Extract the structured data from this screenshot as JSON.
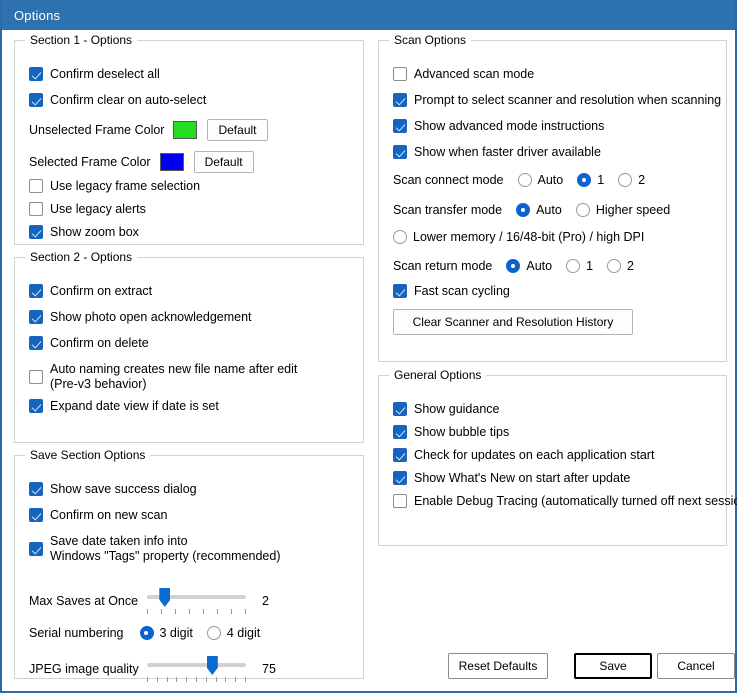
{
  "window": {
    "title": "Options",
    "accent": "#2D71AE"
  },
  "colors": {
    "unselected_frame": "#22DD22",
    "selected_frame": "#0000EE",
    "checkbox_on": "#1565C0",
    "radio_on": "#0B63CE",
    "slider_thumb": "#0B6BD1"
  },
  "section1": {
    "legend": "Section 1 - Options",
    "items": [
      {
        "label": "Confirm deselect all",
        "checked": true
      },
      {
        "label": "Confirm clear on auto-select",
        "checked": true
      }
    ],
    "unselected_frame_color_label": "Unselected Frame Color",
    "unselected_default_button": "Default",
    "selected_frame_color_label": "Selected Frame Color",
    "selected_default_button": "Default",
    "items2": [
      {
        "label": "Use legacy frame selection",
        "checked": false
      },
      {
        "label": "Use legacy alerts",
        "checked": false
      },
      {
        "label": "Show zoom box",
        "checked": true
      }
    ]
  },
  "section2": {
    "legend": "Section 2 - Options",
    "items": [
      {
        "label": "Confirm on extract",
        "checked": true
      },
      {
        "label": "Show photo open acknowledgement",
        "checked": true
      },
      {
        "label": "Confirm on delete",
        "checked": true
      },
      {
        "label": "Auto naming creates new file name after edit",
        "label2": "(Pre-v3 behavior)",
        "checked": false
      },
      {
        "label": "Expand date view if date is set",
        "checked": true
      }
    ]
  },
  "save_section": {
    "legend": "Save Section Options",
    "items": [
      {
        "label": "Show save success dialog",
        "checked": true
      },
      {
        "label": "Confirm on new scan",
        "checked": true
      },
      {
        "label": "Save date taken info into",
        "label2": "Windows \"Tags\" property (recommended)",
        "checked": true
      }
    ],
    "max_saves": {
      "label": "Max Saves at Once",
      "value": "2",
      "percent": 14,
      "ticks": 8
    },
    "serial": {
      "label": "Serial numbering",
      "options": [
        {
          "label": "3 digit",
          "selected": true
        },
        {
          "label": "4 digit",
          "selected": false
        }
      ]
    },
    "jpeg": {
      "label": "JPEG image quality",
      "value": "75",
      "percent": 68,
      "ticks": 11
    }
  },
  "scan_options": {
    "legend": "Scan Options",
    "items": [
      {
        "label": "Advanced scan mode",
        "checked": false
      },
      {
        "label": "Prompt to select scanner and resolution when scanning",
        "checked": true
      },
      {
        "label": "Show advanced mode instructions",
        "checked": true
      },
      {
        "label": "Show when faster driver available",
        "checked": true
      }
    ],
    "connect_mode": {
      "label": "Scan connect mode",
      "options": [
        {
          "label": "Auto",
          "selected": false
        },
        {
          "label": "1",
          "selected": true
        },
        {
          "label": "2",
          "selected": false
        }
      ]
    },
    "transfer_mode": {
      "label": "Scan transfer mode",
      "options": [
        {
          "label": "Auto",
          "selected": true
        },
        {
          "label": "Higher speed",
          "selected": false
        }
      ],
      "extra_option": {
        "label": "Lower memory / 16/48-bit (Pro) / high DPI",
        "selected": false
      }
    },
    "return_mode": {
      "label": "Scan return mode",
      "options": [
        {
          "label": "Auto",
          "selected": true
        },
        {
          "label": "1",
          "selected": false
        },
        {
          "label": "2",
          "selected": false
        }
      ]
    },
    "fast_scan": {
      "label": "Fast scan cycling",
      "checked": true
    },
    "clear_history_button": "Clear Scanner and Resolution History"
  },
  "general_options": {
    "legend": "General Options",
    "items": [
      {
        "label": "Show guidance",
        "checked": true
      },
      {
        "label": "Show bubble tips",
        "checked": true
      },
      {
        "label": "Check for updates on each application start",
        "checked": true
      },
      {
        "label": "Show What's New on start after update",
        "checked": true
      },
      {
        "label": "Enable Debug Tracing (automatically turned off next session)",
        "checked": false
      }
    ]
  },
  "dialog_buttons": {
    "reset": "Reset Defaults",
    "save": "Save",
    "cancel": "Cancel"
  }
}
